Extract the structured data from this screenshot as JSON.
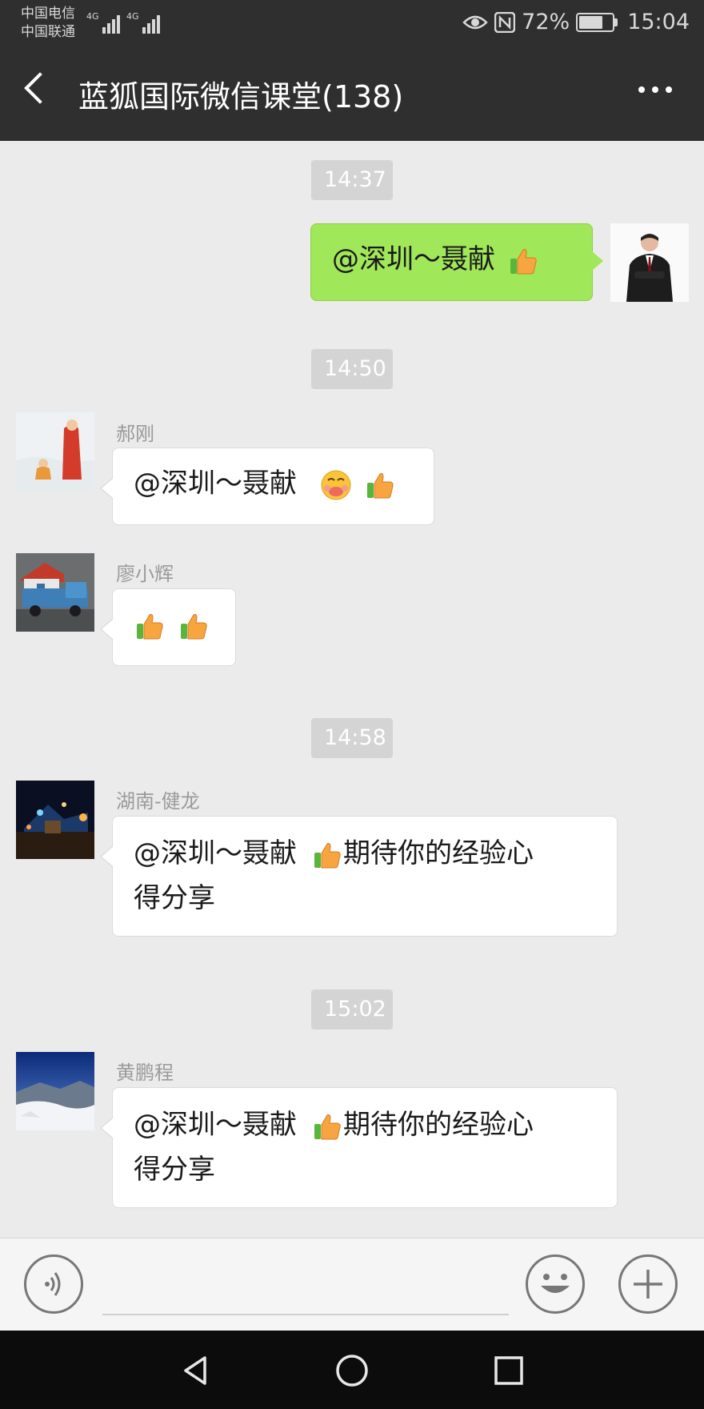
{
  "status_bar": {
    "carrier1": "中国电信",
    "carrier2": "中国联通",
    "net1": "4G",
    "net2": "4G",
    "battery_percent": "72%",
    "battery_level": 0.72,
    "time": "15:04"
  },
  "header": {
    "title": "蓝狐国际微信课堂(138)"
  },
  "chat": {
    "t1": "14:37",
    "t2": "14:50",
    "t3": "14:58",
    "t4": "15:02",
    "m1": {
      "text": "@深圳～聂献",
      "emoji": [
        "thumbs-up"
      ]
    },
    "m2": {
      "sender": "郝刚",
      "text": "@深圳～聂献",
      "emoji": [
        "grin-face",
        "thumbs-up"
      ]
    },
    "m3": {
      "sender": "廖小辉",
      "emoji": [
        "thumbs-up",
        "thumbs-up"
      ]
    },
    "m4": {
      "sender": "湖南-健龙",
      "text_a": "@深圳～聂献",
      "text_b": "期待你的经验心",
      "text_c": "得分享"
    },
    "m5": {
      "sender": "黄鹏程",
      "text_a": "@深圳～聂献",
      "text_b": "期待你的经验心",
      "text_c": "得分享"
    }
  },
  "colors": {
    "header_bg": "#2f2f2f",
    "chat_bg": "#ebebeb",
    "my_bubble": "#a0e75a",
    "other_bubble": "#ffffff"
  }
}
